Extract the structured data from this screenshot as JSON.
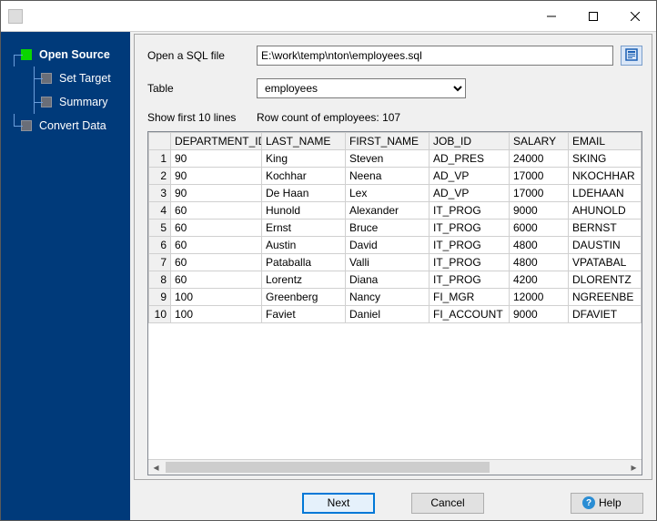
{
  "titlebar": {
    "title": ""
  },
  "sidebar": {
    "items": [
      {
        "label": "Open Source",
        "active": true,
        "child": false
      },
      {
        "label": "Set Target",
        "active": false,
        "child": true
      },
      {
        "label": "Summary",
        "active": false,
        "child": true
      },
      {
        "label": "Convert Data",
        "active": false,
        "child": false
      }
    ]
  },
  "form": {
    "open_sql_label": "Open a SQL file",
    "sql_path": "E:\\work\\temp\\nton\\employees.sql",
    "table_label": "Table",
    "table_selected": "employees",
    "show_first_label": "Show first 10 lines",
    "row_count_label": "Row count of employees: 107"
  },
  "grid": {
    "columns": [
      "DEPARTMENT_ID",
      "LAST_NAME",
      "FIRST_NAME",
      "JOB_ID",
      "SALARY",
      "EMAIL"
    ],
    "rows": [
      [
        "90",
        "King",
        "Steven",
        "AD_PRES",
        "24000",
        "SKING"
      ],
      [
        "90",
        "Kochhar",
        "Neena",
        "AD_VP",
        "17000",
        "NKOCHHAR"
      ],
      [
        "90",
        "De Haan",
        "Lex",
        "AD_VP",
        "17000",
        "LDEHAAN"
      ],
      [
        "60",
        "Hunold",
        "Alexander",
        "IT_PROG",
        "9000",
        "AHUNOLD"
      ],
      [
        "60",
        "Ernst",
        "Bruce",
        "IT_PROG",
        "6000",
        "BERNST"
      ],
      [
        "60",
        "Austin",
        "David",
        "IT_PROG",
        "4800",
        "DAUSTIN"
      ],
      [
        "60",
        "Pataballa",
        "Valli",
        "IT_PROG",
        "4800",
        "VPATABAL"
      ],
      [
        "60",
        "Lorentz",
        "Diana",
        "IT_PROG",
        "4200",
        "DLORENTZ"
      ],
      [
        "100",
        "Greenberg",
        "Nancy",
        "FI_MGR",
        "12000",
        "NGREENBE"
      ],
      [
        "100",
        "Faviet",
        "Daniel",
        "FI_ACCOUNT",
        "9000",
        "DFAVIET"
      ]
    ]
  },
  "footer": {
    "next_label": "Next",
    "cancel_label": "Cancel",
    "help_label": "Help"
  }
}
